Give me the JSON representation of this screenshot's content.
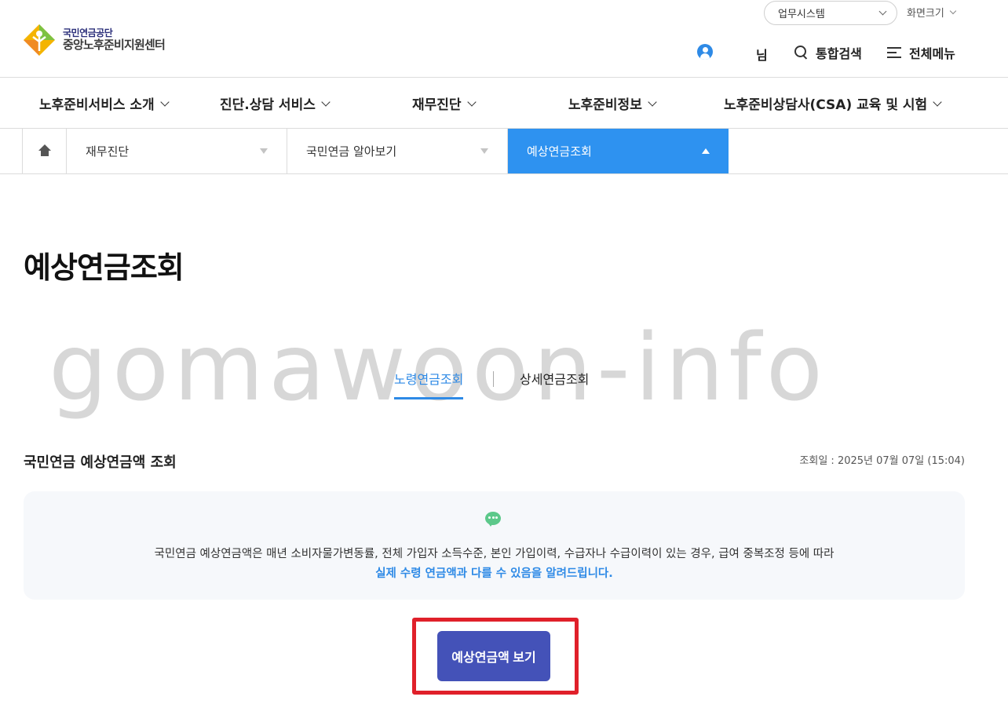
{
  "header": {
    "logo": {
      "line1": "국민연금공단",
      "line2": "중앙노후준비지원센터"
    },
    "system_select": "업무시스템",
    "screen_size": "화면크기",
    "user_suffix": "님",
    "search_label": "통합검색",
    "menu_label": "전체메뉴"
  },
  "gnb": [
    {
      "label": "노후준비서비스 소개"
    },
    {
      "label": "진단.상담 서비스"
    },
    {
      "label": "재무진단"
    },
    {
      "label": "노후준비정보"
    },
    {
      "label": "노후준비상담사(CSA) 교육 및 시험"
    }
  ],
  "location": {
    "home_icon": "home-icon",
    "depth1": "재무진단",
    "depth2": "국민연금 알아보기",
    "depth3": "예상연금조회"
  },
  "page_title": "예상연금조회",
  "watermark": "gomawoon-info",
  "tabs": [
    {
      "label": "노령연금조회",
      "active": true
    },
    {
      "label": "상세연금조회",
      "active": false
    }
  ],
  "section": {
    "title": "국민연금 예상연금액 조회",
    "inquiry_date": "조회일 : 2025년 07월 07일 (15:04)"
  },
  "notice": {
    "icon": "chat-bubble-icon",
    "line1": "국민연금 예상연금액은 매년 소비자물가변동률, 전체 가입자 소득수준, 본인 가입이력, 수급자나 수급이력이 있는 경우, 급여 중복조정 등에 따라",
    "line2": "실제 수령 연금액과 다를 수 있음을 알려드립니다."
  },
  "action": {
    "button_label": "예상연금액 보기"
  },
  "colors": {
    "accent_blue": "#2e92f0",
    "tab_blue": "#2e8ae6",
    "button": "#4452b8",
    "highlight": "#e0202a",
    "notice_icon": "#5cc88a"
  }
}
